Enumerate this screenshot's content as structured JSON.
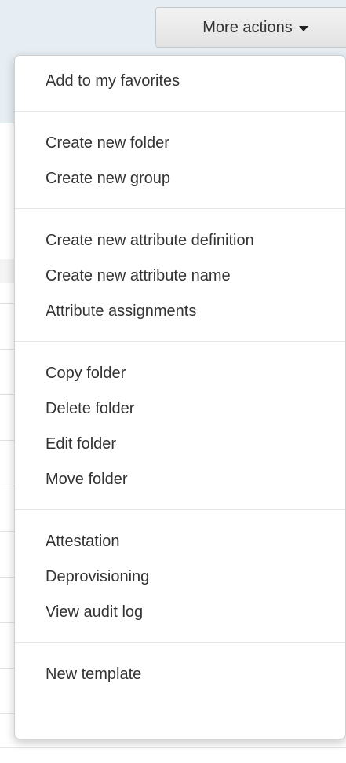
{
  "toolbar": {
    "more_actions_label": "More actions"
  },
  "menu": {
    "groups": [
      [
        "Add to my favorites"
      ],
      [
        "Create new folder",
        "Create new group"
      ],
      [
        "Create new attribute definition",
        "Create new attribute name",
        "Attribute assignments"
      ],
      [
        "Copy folder",
        "Delete folder",
        "Edit folder",
        "Move folder"
      ],
      [
        "Attestation",
        "Deprovisioning",
        "View audit log"
      ],
      [
        "New template"
      ]
    ]
  },
  "colors": {
    "menu_text": "#333333",
    "divider": "#e5e5e5",
    "page_header_bg": "#e6eef3"
  }
}
